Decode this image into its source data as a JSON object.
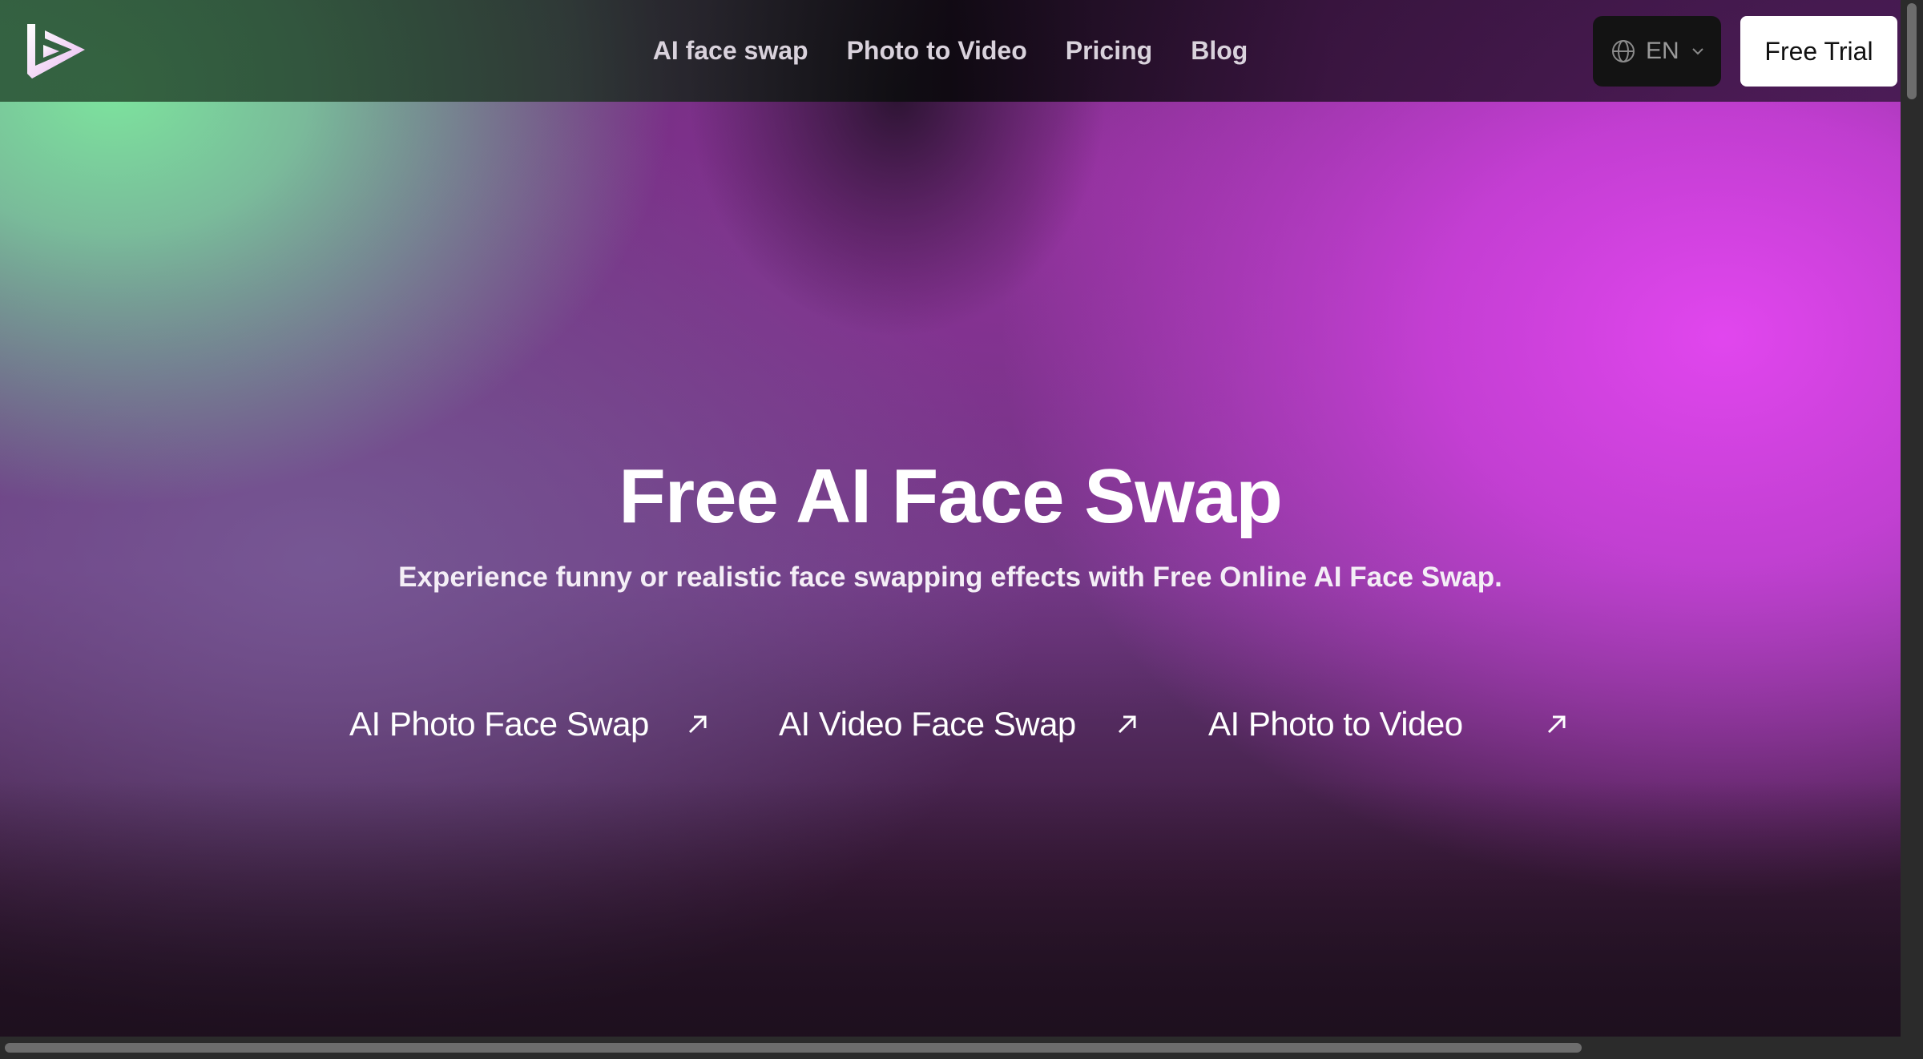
{
  "nav": {
    "items": [
      {
        "label": "AI face swap"
      },
      {
        "label": "Photo to Video"
      },
      {
        "label": "Pricing"
      },
      {
        "label": "Blog"
      }
    ]
  },
  "language": {
    "value": "EN",
    "icon": "globe-icon"
  },
  "cta": {
    "label": "Free Trial"
  },
  "hero": {
    "title": "Free AI Face Swap",
    "subtitle": "Experience funny or realistic face swapping effects with Free Online AI Face Swap."
  },
  "features": [
    {
      "label": "AI Photo Face Swap",
      "icon": "arrow-up-right-icon"
    },
    {
      "label": "AI Video Face Swap",
      "icon": "arrow-up-right-icon"
    },
    {
      "label": "AI Photo to Video",
      "icon": "arrow-up-right-icon"
    }
  ],
  "colors": {
    "green_glow": "#7DE49E",
    "magenta_glow": "#E146EE",
    "cta_background": "#FFFFFF",
    "language_background": "#131313"
  }
}
